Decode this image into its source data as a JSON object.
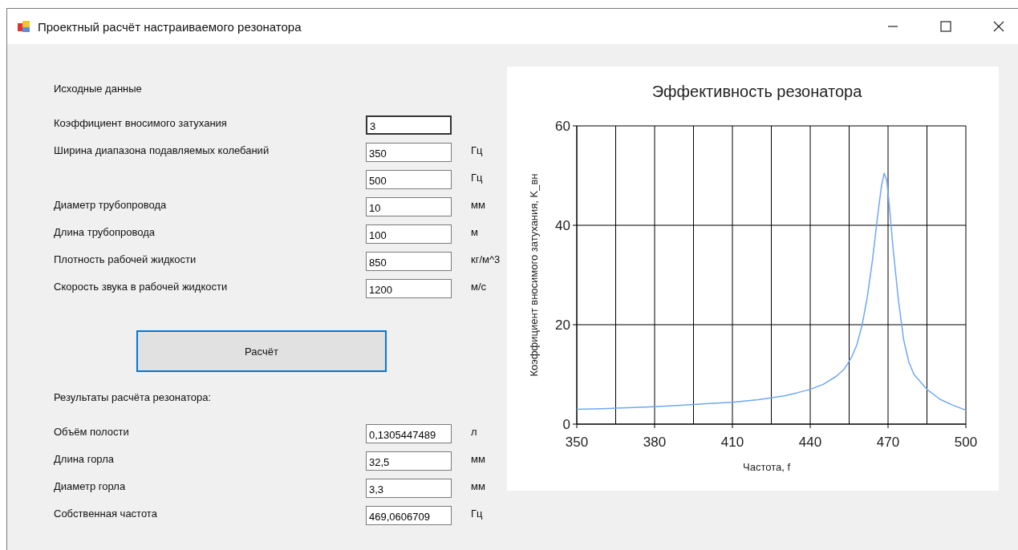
{
  "window": {
    "title": "Проектный расчёт настраиваемого резонатора"
  },
  "inputs": {
    "heading": "Исходные данные",
    "rows": [
      {
        "label": "Коэффициент вносимого затухания",
        "value": "3",
        "focused": true
      },
      {
        "label": "Ширина диапазона подавляемых колебаний",
        "value": "350",
        "unit": "Гц",
        "focused": false
      },
      {
        "value": "500",
        "unit": "Гц",
        "focused": false
      },
      {
        "label": "Диаметр трубопровода",
        "value": "10",
        "unit": "мм",
        "focused": false
      },
      {
        "label": "Длина трубопровода",
        "value": "100",
        "unit": "м",
        "focused": false
      },
      {
        "label": "Плотность рабочей жидкости",
        "value": "850",
        "unit": "кг/м^3",
        "focused": false
      },
      {
        "label": "Скорость звука в рабочей жидкости",
        "value": "1200",
        "unit": "м/с",
        "focused": false
      }
    ]
  },
  "calculate_button": "Расчёт",
  "results": {
    "heading": "Результаты расчёта резонатора:",
    "rows": [
      {
        "label": "Объём полости",
        "value": "0,1305447489",
        "unit": "л"
      },
      {
        "label": "Длина горла",
        "value": "32,5",
        "unit": "мм"
      },
      {
        "label": "Диаметр горла",
        "value": "3,3",
        "unit": "мм"
      },
      {
        "label": "Собственная частота",
        "value": "469,0606709",
        "unit": "Гц"
      }
    ]
  },
  "chart": {
    "chart_data": {
      "type": "line",
      "title": "Эффективность резонатора",
      "xlabel": "Частота, f",
      "ylabel": "Коэффициент вносимого затухания, K_вн",
      "xlim": [
        350,
        500
      ],
      "ylim": [
        0,
        60
      ],
      "xticks": [
        350,
        380,
        410,
        440,
        470,
        500
      ],
      "yticks": [
        0,
        20,
        40,
        60
      ],
      "grid": true,
      "x": [
        350,
        360,
        370,
        380,
        390,
        400,
        410,
        420,
        430,
        435,
        440,
        445,
        450,
        453,
        456,
        458,
        460,
        462,
        464,
        466,
        467.5,
        468.5,
        469.5,
        470.5,
        472,
        474,
        476,
        478,
        480,
        485,
        490,
        495,
        500
      ],
      "series": [
        {
          "color": "#6fa8f5",
          "values": [
            3.0,
            3.1,
            3.3,
            3.5,
            3.8,
            4.1,
            4.4,
            4.9,
            5.7,
            6.3,
            7.0,
            8.0,
            9.6,
            11,
            13.5,
            16,
            20,
            25.5,
            33,
            42,
            48,
            50.5,
            49,
            44,
            35,
            25,
            17,
            12.5,
            10,
            7,
            5,
            3.8,
            2.8
          ]
        }
      ]
    }
  }
}
